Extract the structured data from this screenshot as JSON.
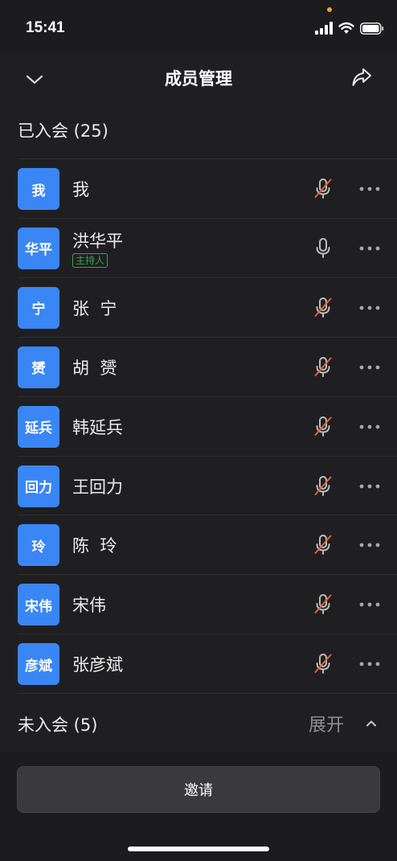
{
  "status_bar": {
    "time": "15:41"
  },
  "header": {
    "title": "成员管理"
  },
  "joined_section": {
    "label": "已入会 (25)"
  },
  "members": [
    {
      "avatar": "我",
      "name": "我",
      "mic": "muted"
    },
    {
      "avatar": "华平",
      "name": "洪华平",
      "badge": "主持人",
      "mic": "on"
    },
    {
      "avatar": "宁",
      "name": "张  宁",
      "mic": "muted"
    },
    {
      "avatar": "赟",
      "name": "胡  赟",
      "mic": "muted"
    },
    {
      "avatar": "延兵",
      "name": "韩延兵",
      "mic": "muted"
    },
    {
      "avatar": "回力",
      "name": "王回力",
      "mic": "muted"
    },
    {
      "avatar": "玲",
      "name": "陈  玲",
      "mic": "muted"
    },
    {
      "avatar": "宋伟",
      "name": "宋伟",
      "mic": "muted"
    },
    {
      "avatar": "彦斌",
      "name": "张彦斌",
      "mic": "muted"
    }
  ],
  "not_joined_section": {
    "label": "未入会 (5)",
    "expand_label": "展开"
  },
  "invite_button": {
    "label": "邀请"
  },
  "colors": {
    "avatar_bg": "#3a86f5",
    "muted_slash": "#e0623a",
    "host_badge": "#37a44a",
    "background": "#1f1f21"
  }
}
